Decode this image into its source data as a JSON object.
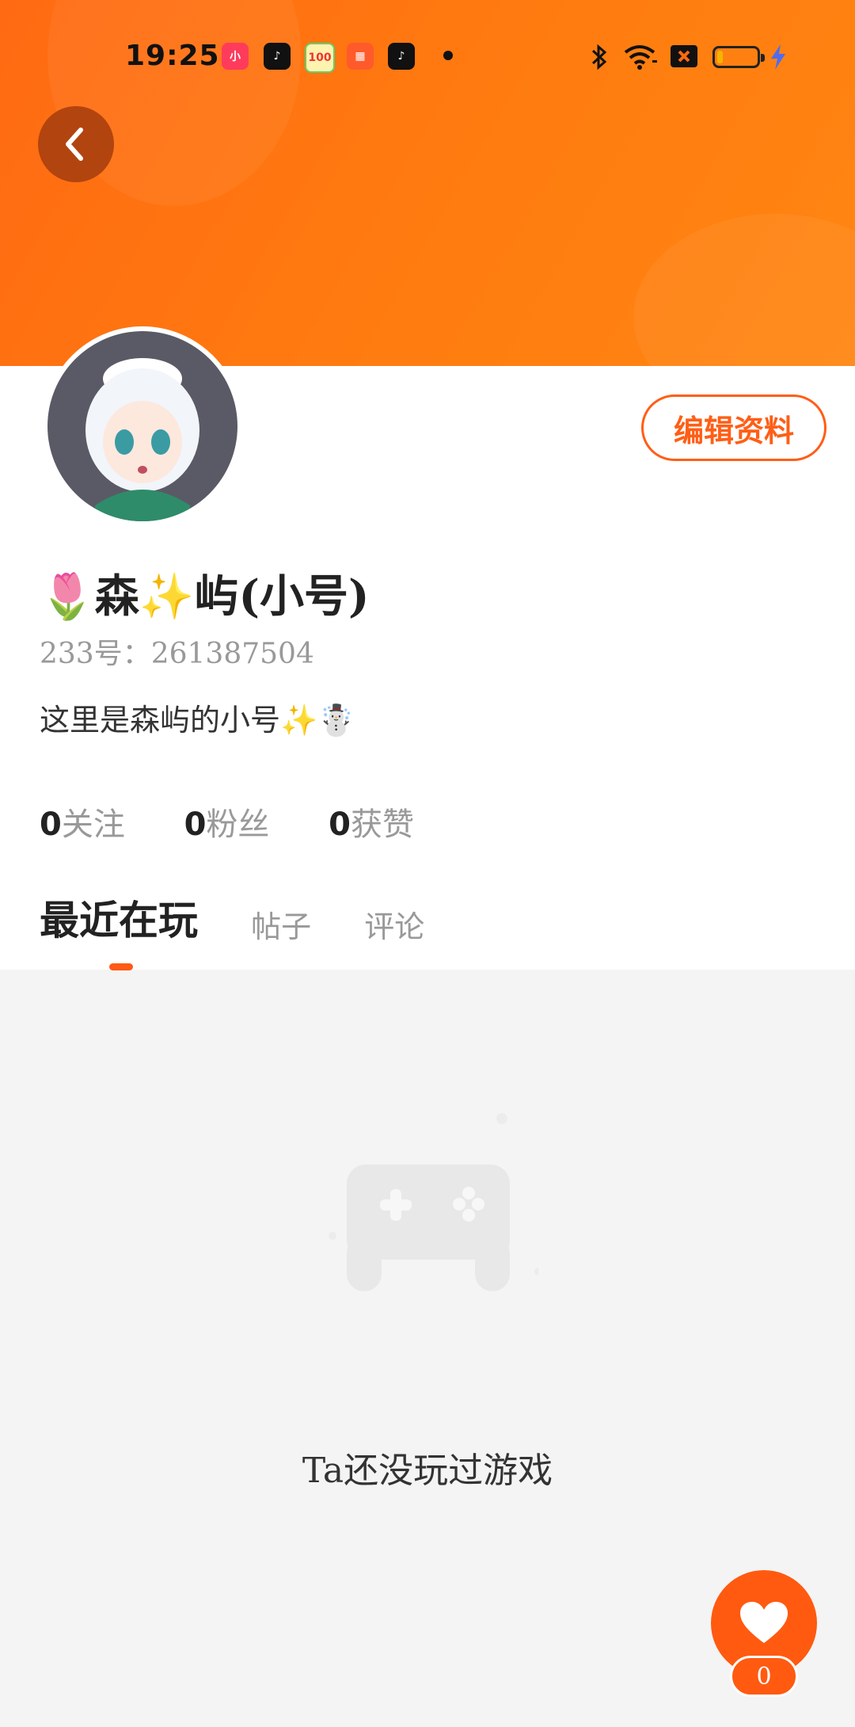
{
  "status_bar": {
    "time": "19:25",
    "notification_icons": [
      "xiaohongshu-icon",
      "tiktok-icon",
      "score-100-icon",
      "app-grid-icon",
      "tiktok-icon"
    ],
    "system_icons": [
      "bluetooth-icon",
      "wifi-icon",
      "sim-no-signal-icon",
      "battery-icon",
      "charging-icon"
    ],
    "battery_level": 0.15
  },
  "profile": {
    "edit_label": "编辑资料",
    "nickname": "🌷森✨屿(小号)",
    "uid": "233号：261387504",
    "bio": "这里是森屿的小号✨☃️",
    "stats": [
      {
        "value": "0",
        "label": "关注"
      },
      {
        "value": "0",
        "label": "粉丝"
      },
      {
        "value": "0",
        "label": "获赞"
      }
    ]
  },
  "tabs": [
    {
      "label": "最近在玩",
      "active": true
    },
    {
      "label": "帖子",
      "active": false
    },
    {
      "label": "评论",
      "active": false
    }
  ],
  "empty_state": {
    "message": "Ta还没玩过游戏",
    "icon": "gamepad-icon"
  },
  "like": {
    "count": "0",
    "icon": "heart-icon"
  },
  "colors": {
    "accent": "#ff5e16",
    "header_gradient_start": "#ff6a12",
    "header_gradient_end": "#ff8612",
    "back_button": "#b2440f"
  }
}
